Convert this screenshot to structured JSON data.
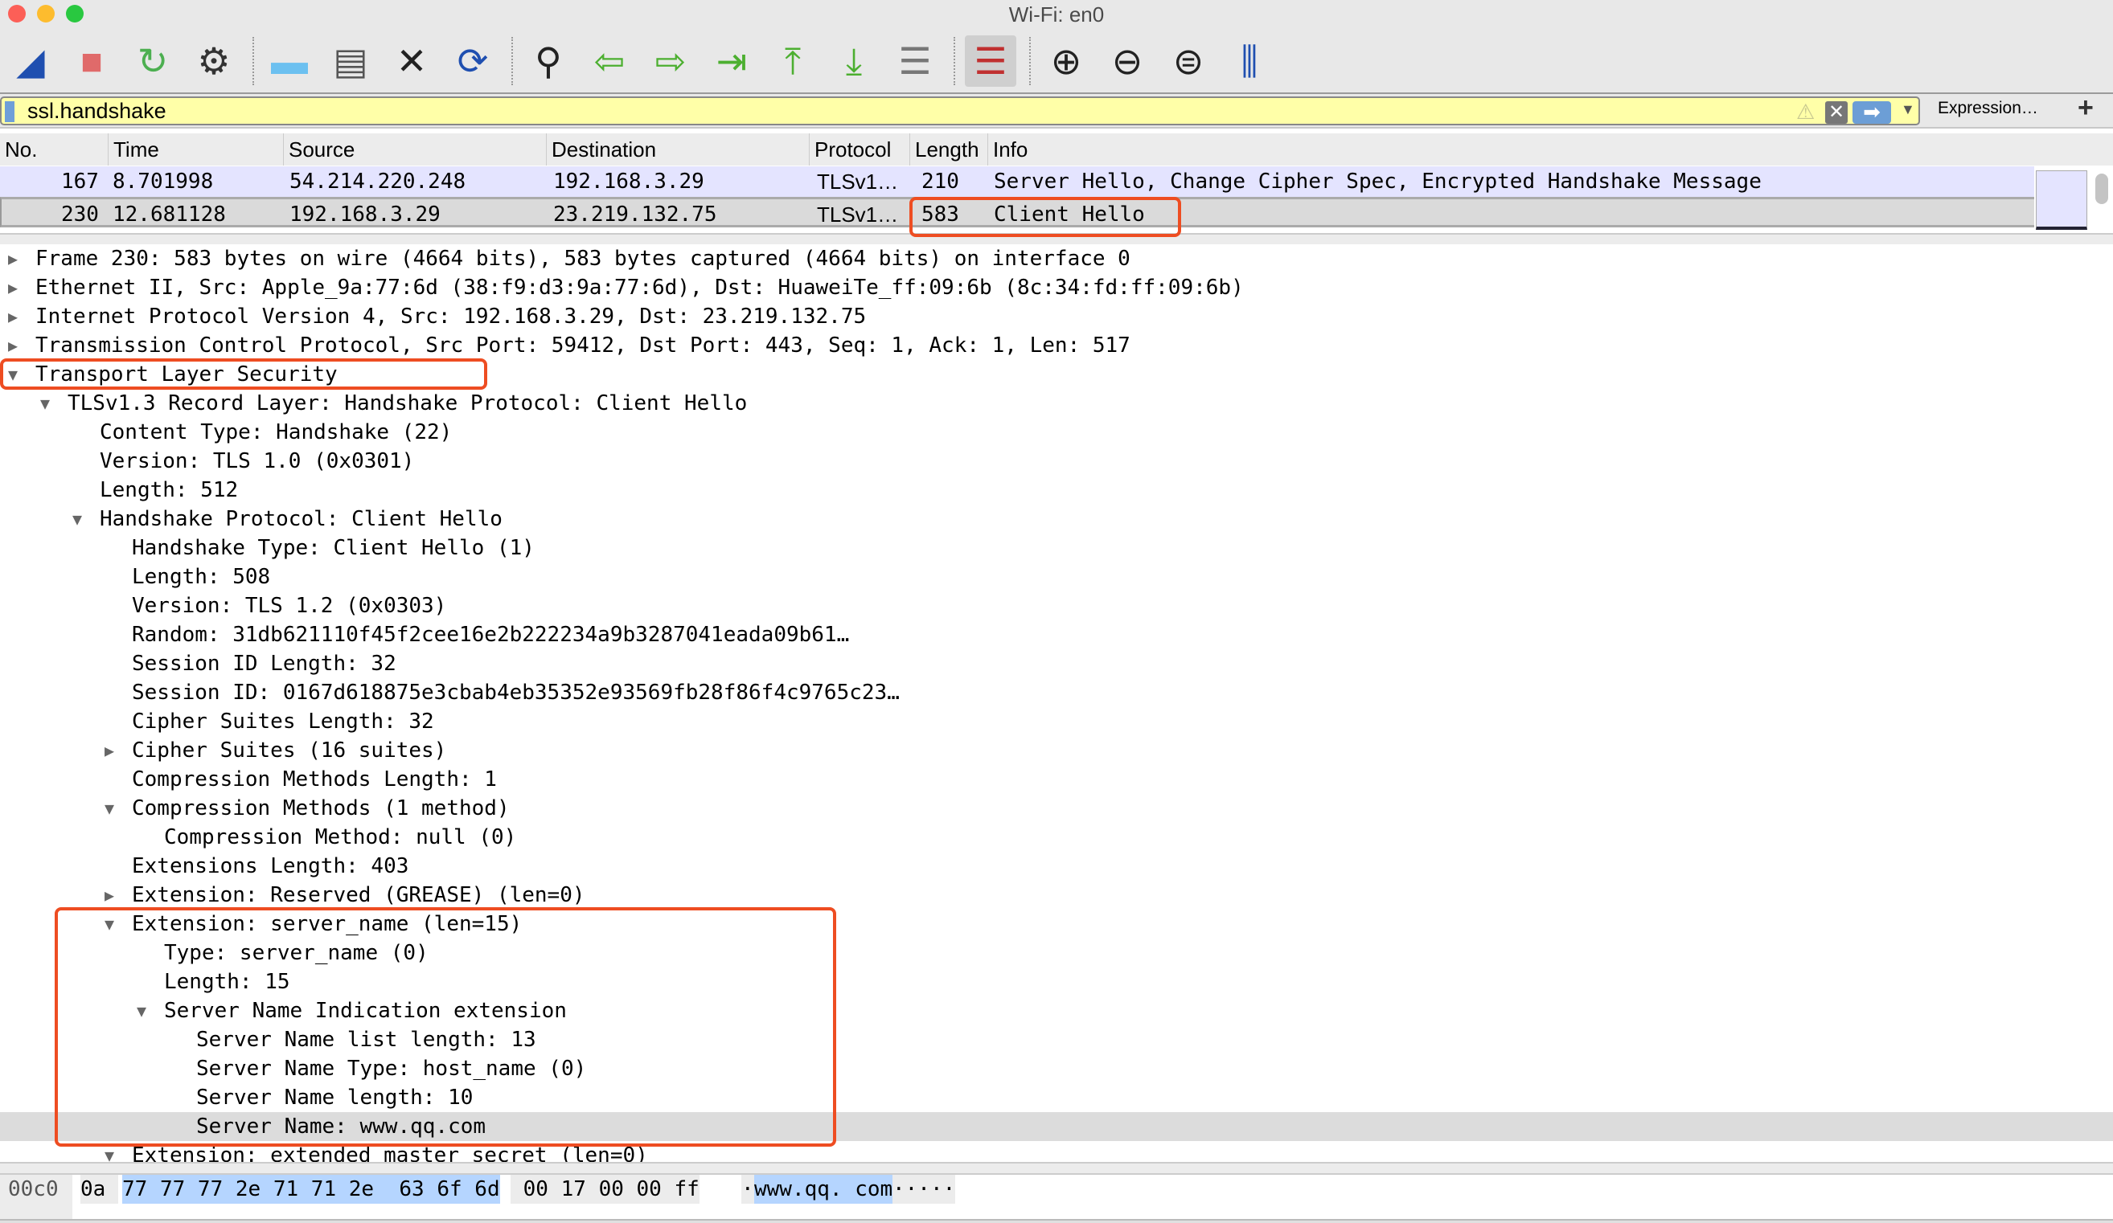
{
  "window": {
    "title": "Wi-Fi: en0"
  },
  "toolbar": {
    "buttons": [
      {
        "name": "start-capture-icon",
        "glyph": "◢",
        "color": "#1f4fb0"
      },
      {
        "name": "stop-capture-icon",
        "glyph": "■",
        "color": "#e06a6a"
      },
      {
        "name": "restart-capture-icon",
        "glyph": "↻",
        "color": "#4caf50"
      },
      {
        "name": "capture-options-icon",
        "glyph": "⚙",
        "color": "#333333"
      },
      {
        "name": "sep"
      },
      {
        "name": "open-file-icon",
        "glyph": "▬",
        "color": "#6cc0f0"
      },
      {
        "name": "save-file-icon",
        "glyph": "▤",
        "color": "#555555"
      },
      {
        "name": "close-file-icon",
        "glyph": "✕",
        "color": "#222222"
      },
      {
        "name": "reload-file-icon",
        "glyph": "⟳",
        "color": "#1f4fb0"
      },
      {
        "name": "sep"
      },
      {
        "name": "find-packet-icon",
        "glyph": "⚲",
        "color": "#222222"
      },
      {
        "name": "go-back-icon",
        "glyph": "⇦",
        "color": "#4caf30"
      },
      {
        "name": "go-forward-icon",
        "glyph": "⇨",
        "color": "#4caf30"
      },
      {
        "name": "go-to-packet-icon",
        "glyph": "⇥",
        "color": "#4caf30"
      },
      {
        "name": "go-first-packet-icon",
        "glyph": "⤒",
        "color": "#4caf30"
      },
      {
        "name": "go-last-packet-icon",
        "glyph": "⤓",
        "color": "#4caf30"
      },
      {
        "name": "autoscroll-icon",
        "glyph": "☰",
        "color": "#777777"
      },
      {
        "name": "sep"
      },
      {
        "name": "colorize-icon",
        "glyph": "☰",
        "color": "#c03030",
        "active": true
      },
      {
        "name": "sep"
      },
      {
        "name": "zoom-in-icon",
        "glyph": "⊕",
        "color": "#222222"
      },
      {
        "name": "zoom-out-icon",
        "glyph": "⊖",
        "color": "#222222"
      },
      {
        "name": "zoom-normal-icon",
        "glyph": "⊜",
        "color": "#222222"
      },
      {
        "name": "resize-columns-icon",
        "glyph": "⫼",
        "color": "#1f4fb0"
      }
    ]
  },
  "filter": {
    "value": "ssl.handshake",
    "expression_label": "Expression…",
    "add_label": "+",
    "bg": "#ffffa8"
  },
  "packet_list": {
    "columns": [
      "No.",
      "Time",
      "Source",
      "Destination",
      "Protocol",
      "Length",
      "Info"
    ],
    "rows": [
      {
        "no": "167",
        "time": "8.701998",
        "source": "54.214.220.248",
        "destination": "192.168.3.29",
        "protocol": "TLSv1…",
        "length": "210",
        "info": "Server Hello, Change Cipher Spec, Encrypted Handshake Message"
      },
      {
        "no": "230",
        "time": "12.681128",
        "source": "192.168.3.29",
        "destination": "23.219.132.75",
        "protocol": "TLSv1…",
        "length": "583",
        "info": "Client Hello"
      }
    ]
  },
  "details": [
    {
      "level": 0,
      "exp": "collapsed",
      "text": "Frame 230: 583 bytes on wire (4664 bits), 583 bytes captured (4664 bits) on interface 0"
    },
    {
      "level": 0,
      "exp": "collapsed",
      "text": "Ethernet II, Src: Apple_9a:77:6d (38:f9:d3:9a:77:6d), Dst: HuaweiTe_ff:09:6b (8c:34:fd:ff:09:6b)"
    },
    {
      "level": 0,
      "exp": "collapsed",
      "text": "Internet Protocol Version 4, Src: 192.168.3.29, Dst: 23.219.132.75"
    },
    {
      "level": 0,
      "exp": "collapsed",
      "text": "Transmission Control Protocol, Src Port: 59412, Dst Port: 443, Seq: 1, Ack: 1, Len: 517"
    },
    {
      "level": 0,
      "exp": "expanded",
      "text": "Transport Layer Security"
    },
    {
      "level": 1,
      "exp": "expanded",
      "text": "TLSv1.3 Record Layer: Handshake Protocol: Client Hello"
    },
    {
      "level": 2,
      "exp": "none",
      "text": "Content Type: Handshake (22)"
    },
    {
      "level": 2,
      "exp": "none",
      "text": "Version: TLS 1.0 (0x0301)"
    },
    {
      "level": 2,
      "exp": "none",
      "text": "Length: 512"
    },
    {
      "level": 2,
      "exp": "expanded",
      "text": "Handshake Protocol: Client Hello"
    },
    {
      "level": 3,
      "exp": "none",
      "text": "Handshake Type: Client Hello (1)"
    },
    {
      "level": 3,
      "exp": "none",
      "text": "Length: 508"
    },
    {
      "level": 3,
      "exp": "none",
      "text": "Version: TLS 1.2 (0x0303)"
    },
    {
      "level": 3,
      "exp": "none",
      "text": "Random: 31db621110f45f2cee16e2b222234a9b3287041eada09b61…"
    },
    {
      "level": 3,
      "exp": "none",
      "text": "Session ID Length: 32"
    },
    {
      "level": 3,
      "exp": "none",
      "text": "Session ID: 0167d618875e3cbab4eb35352e93569fb28f86f4c9765c23…"
    },
    {
      "level": 3,
      "exp": "none",
      "text": "Cipher Suites Length: 32"
    },
    {
      "level": 3,
      "exp": "collapsed",
      "text": "Cipher Suites (16 suites)"
    },
    {
      "level": 3,
      "exp": "none",
      "text": "Compression Methods Length: 1"
    },
    {
      "level": 3,
      "exp": "expanded",
      "text": "Compression Methods (1 method)"
    },
    {
      "level": 4,
      "exp": "none",
      "text": "Compression Method: null (0)"
    },
    {
      "level": 3,
      "exp": "none",
      "text": "Extensions Length: 403"
    },
    {
      "level": 3,
      "exp": "collapsed",
      "text": "Extension: Reserved (GREASE) (len=0)"
    },
    {
      "level": 3,
      "exp": "expanded",
      "text": "Extension: server_name (len=15)"
    },
    {
      "level": 4,
      "exp": "none",
      "text": "Type: server_name (0)"
    },
    {
      "level": 4,
      "exp": "none",
      "text": "Length: 15"
    },
    {
      "level": 4,
      "exp": "expanded",
      "text": "Server Name Indication extension"
    },
    {
      "level": 5,
      "exp": "none",
      "text": "Server Name list length: 13"
    },
    {
      "level": 5,
      "exp": "none",
      "text": "Server Name Type: host_name (0)"
    },
    {
      "level": 5,
      "exp": "none",
      "text": "Server Name length: 10"
    },
    {
      "level": 5,
      "exp": "none",
      "text": "Server Name: www.qq.com",
      "selected": true
    },
    {
      "level": 3,
      "exp": "expanded",
      "text": "Extension: extended_master_secret (len=0)"
    }
  ],
  "bytes": {
    "offset": "00c0",
    "hex_pre": "0a ",
    "hex_hl": "77 77 77 2e 71 71 2e  63 6f 6d",
    "hex_post": " 00 17 00 00 ff",
    "ascii_pre": "·",
    "ascii_hl": "www.qq. com",
    "ascii_post": "·····"
  },
  "colors": {
    "highlight_box": "#ee4d22",
    "selected_row": "#dcdcdc",
    "tls_row": "#e4e4ff",
    "byte_highlight": "#b5d5ff"
  }
}
